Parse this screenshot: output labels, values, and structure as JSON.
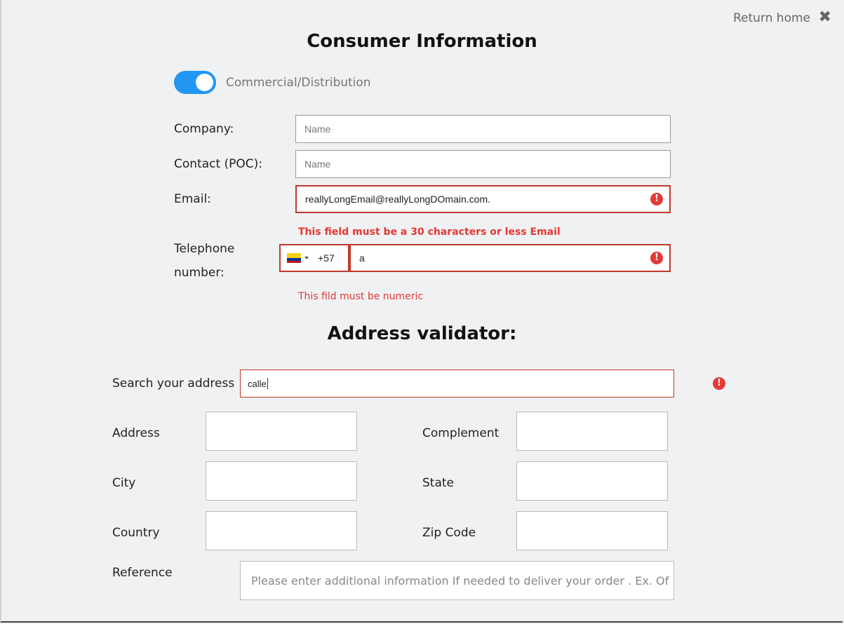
{
  "header": {
    "return_home": "Return home",
    "close_glyph": "✖",
    "title": "Consumer Information"
  },
  "toggle": {
    "label": "Commercial/Distribution",
    "on": true
  },
  "fields": {
    "company": {
      "label": "Company:",
      "placeholder": "Name",
      "value": ""
    },
    "contact": {
      "label": "Contact (POC):",
      "placeholder": "Name",
      "value": ""
    },
    "email": {
      "label": "Email:",
      "value": "reallyLongEmail@reallyLongDOmain.com.",
      "error": "This field must be a 30 characters or less Email"
    },
    "phone": {
      "label_line1": "Telephone",
      "label_line2": "number:",
      "dial_code": "+57",
      "value": "a",
      "error": "This fild must be numeric"
    }
  },
  "address": {
    "title": "Address validator:",
    "search_label": "Search your address",
    "search_value": "calle",
    "address_label": "Address",
    "complement_label": "Complement",
    "city_label": "City",
    "state_label": "State",
    "country_label": "Country",
    "zip_label": "Zip Code",
    "reference_label": "Reference",
    "reference_placeholder": "Please enter additional information If needed to deliver your order . Ex. Of"
  },
  "colors": {
    "accent": "#2196f3",
    "error": "#e53935",
    "background": "#f0f1f3"
  }
}
